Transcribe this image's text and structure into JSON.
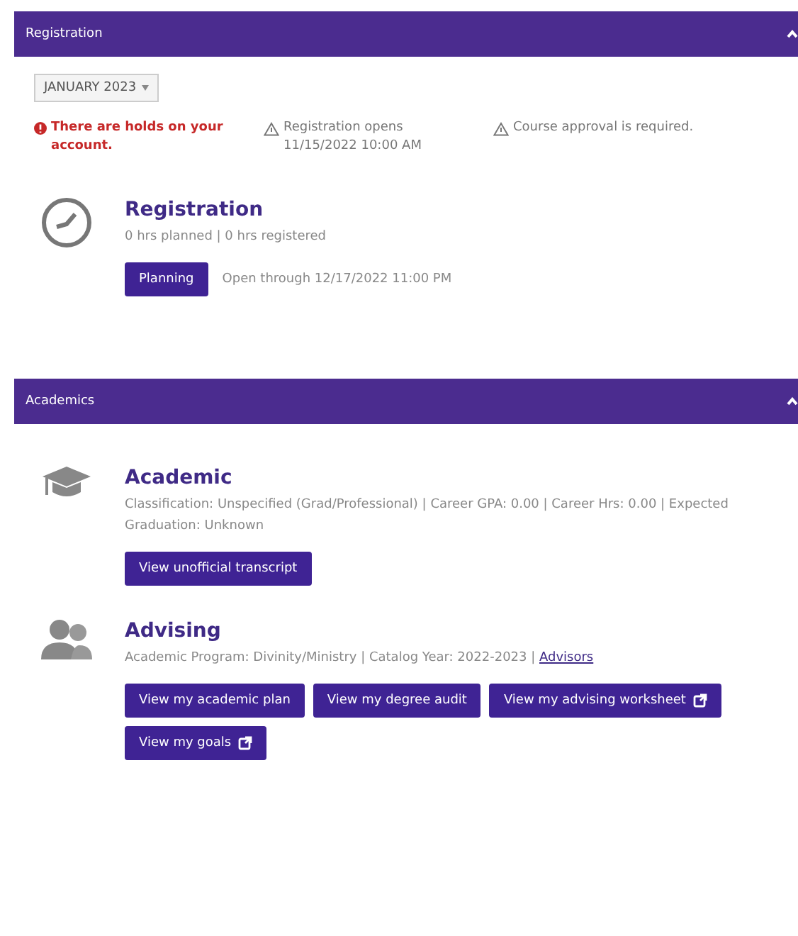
{
  "registration": {
    "title": "Registration",
    "expanded": true,
    "term": "JANUARY 2023",
    "alerts": [
      {
        "kind": "error",
        "text": "There are holds on your account."
      },
      {
        "kind": "warning",
        "text": "Registration opens 11/15/2022 10:00 AM"
      },
      {
        "kind": "warning",
        "text": "Course approval is required."
      }
    ],
    "item": {
      "title": "Registration",
      "summary": "0 hrs planned | 0 hrs registered",
      "button": "Planning",
      "note": "Open through 12/17/2022 11:00 PM"
    }
  },
  "academics": {
    "title": "Academics",
    "expanded": true,
    "items": [
      {
        "kind": "academic",
        "title": "Academic",
        "summary": "Classification: Unspecified (Grad/Professional) | Career GPA: 0.00 | Career Hrs: 0.00 | Expected Graduation: Unknown",
        "buttons": [
          {
            "label": "View unofficial transcript",
            "external": false
          }
        ]
      },
      {
        "kind": "advising",
        "title": "Advising",
        "summary": "Academic Program: Divinity/Ministry | Catalog Year: 2022-2023 | ",
        "link": "Advisors",
        "buttons": [
          {
            "label": "View my academic plan",
            "external": false
          },
          {
            "label": "View my degree audit",
            "external": false
          },
          {
            "label": "View my advising worksheet",
            "external": true
          },
          {
            "label": "View my goals",
            "external": true
          }
        ]
      }
    ]
  }
}
